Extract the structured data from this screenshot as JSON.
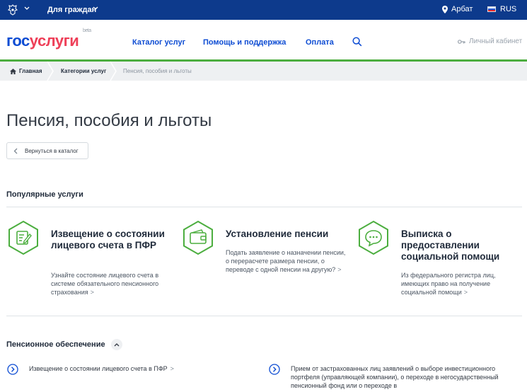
{
  "topbar": {
    "citizens_label": "Для граждан",
    "location_label": "Арбат",
    "lang_label": "RUS"
  },
  "header": {
    "logo_gos": "гос",
    "logo_uslugi": "услуги",
    "logo_beta": "beta",
    "nav": [
      "Каталог услуг",
      "Помощь и поддержка",
      "Оплата"
    ],
    "cabinet_label": "Личный кабинет"
  },
  "breadcrumb": {
    "home": "Главная",
    "categories": "Категории услуг",
    "current": "Пенсия, пособия и льготы"
  },
  "page": {
    "title": "Пенсия, пособия и льготы",
    "back_label": "Вернуться в каталог"
  },
  "popular": {
    "heading": "Популярные услуги",
    "cards": [
      {
        "title": "Извещение о состоянии лицевого счета в ПФР",
        "desc": "Узнайте состояние лицевого счета в системе обязательного пенсионного страхования",
        "icon": "document-edit-icon"
      },
      {
        "title": "Установление пенсии",
        "desc": "Подать заявление о назначении пенсии, о перерасчете размера пенсии, о переводе с одной пенсии на другую?",
        "icon": "wallet-icon"
      },
      {
        "title": "Выписка о предоставлении социальной помощи",
        "desc": "Из федерального регистра лиц, имеющих право на получение социальной помощи",
        "icon": "chat-bubble-icon"
      }
    ]
  },
  "pension": {
    "heading": "Пенсионное обеспечение",
    "links": [
      "Извещение о состоянии лицевого счета в ПФР",
      "Прием от застрахованных лиц заявлений о выборе инвестиционного портфеля (управляющей компании), о переходе в негосударственный пенсионный фонд или о переходе в"
    ]
  },
  "colors": {
    "topbar": "#0d3a8c",
    "brand_blue": "#0d4cd3",
    "brand_red": "#ee3f58",
    "accent_green": "#4cae3f"
  }
}
